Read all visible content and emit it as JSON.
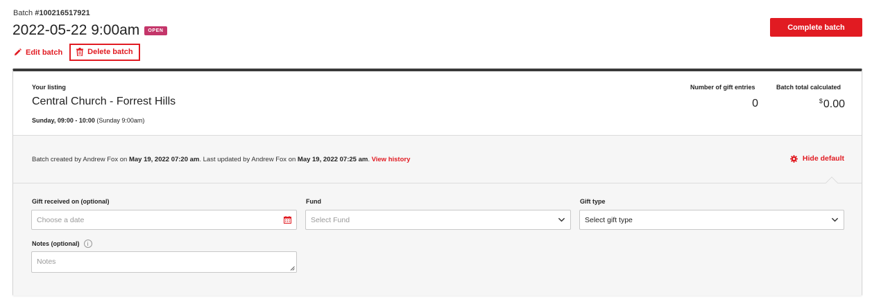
{
  "header": {
    "batch_prefix": "Batch",
    "batch_number": "#100216517921",
    "title": "2022-05-22 9:00am",
    "status": "OPEN",
    "edit_label": "Edit batch",
    "delete_label": "Delete batch",
    "complete_label": "Complete batch"
  },
  "summary": {
    "listing_label": "Your listing",
    "listing_name": "Central Church - Forrest Hills",
    "time_bold": "Sunday, 09:00 - 10:00",
    "time_extra": "(Sunday 9:00am)",
    "entries_label": "Number of gift entries",
    "entries_value": "0",
    "total_label": "Batch total calculated",
    "total_currency": "$",
    "total_value": "0.00"
  },
  "meta": {
    "created_prefix": "Batch created by Andrew Fox on",
    "created_date": "May 19, 2022 07:20 am",
    "updated_prefix": ". Last updated by Andrew Fox on",
    "updated_date": "May 19, 2022 07:25 am",
    "updated_suffix": ".",
    "history_link": "View history",
    "hide_default_label": "Hide default"
  },
  "form": {
    "gift_date_label": "Gift received on (optional)",
    "gift_date_placeholder": "Choose a date",
    "fund_label": "Fund",
    "fund_placeholder": "Select Fund",
    "gift_type_label": "Gift type",
    "gift_type_value": "Select gift type",
    "notes_label": "Notes (optional)",
    "notes_placeholder": "Notes",
    "info_glyph": "i"
  },
  "colors": {
    "accent": "#e11b22",
    "status_badge": "#c4366a",
    "card_top_border": "#3a3a3a"
  },
  "icons": {
    "edit": "pencil-icon",
    "delete": "trash-icon",
    "settings": "gear-icon",
    "calendar": "calendar-icon",
    "dropdown": "chevron-down-icon",
    "info": "info-icon"
  }
}
